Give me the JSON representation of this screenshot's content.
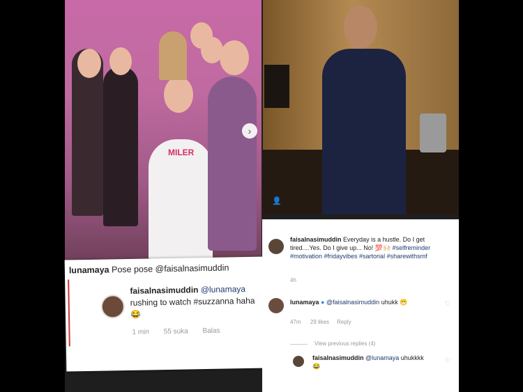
{
  "post1": {
    "comment_user": "lunamaya",
    "comment_text": "Pose pose @faisalnasimuddin",
    "reply_user": "faisalnasimuddin",
    "reply_mention": "@lunamaya",
    "reply_text": "rushing to watch #suzzanna haha",
    "reply_time": "1 min",
    "reply_likes": "55 suka",
    "reply_button": "Balas",
    "tshirt_text": "MILER"
  },
  "post2": {
    "caption_user": "faisalnasimuddin",
    "caption_text": "Everyday is a hustle. Do I get tired....Yes. Do I give up... No!",
    "caption_hashtags": "#selfreminder #motivation #fridayvibes #sartorial #sharewithsmf",
    "caption_time": "4h",
    "comment1_user": "lunamaya",
    "comment1_mention": "@faisalnasimuddin",
    "comment1_text": "uhukk",
    "comment1_time": "47m",
    "comment1_likes": "29 likes",
    "comment1_reply": "Reply",
    "view_replies": "View previous replies (4)",
    "comment2_user": "faisalnasimuddin",
    "comment2_mention": "@lunamaya",
    "comment2_text": "uhukkkk"
  },
  "icons": {
    "heart": "heart-icon",
    "user_tag": "user-tag-icon",
    "carousel_next": "chevron-right-icon"
  }
}
